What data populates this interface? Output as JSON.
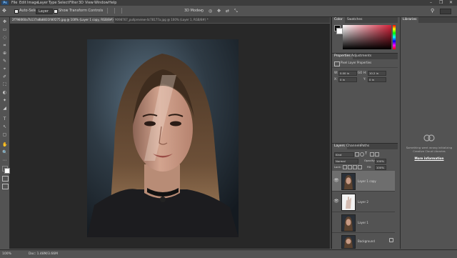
{
  "app": {
    "logo": "Ps"
  },
  "menu": [
    "File",
    "Edit",
    "Image",
    "Layer",
    "Type",
    "Select",
    "Filter",
    "3D",
    "View",
    "Window",
    "Help"
  ],
  "window_controls": {
    "minimize": "–",
    "restore": "❐",
    "close": "✕"
  },
  "options_bar": {
    "auto_select_label": "Auto-Select:",
    "auto_select_value": "Layer",
    "show_transform_label": "Show Transform Controls",
    "mode_3d_label": "3D Mode:"
  },
  "document_tabs": [
    {
      "label": "2f798060a7b137a8b8831f46f275.jpg @ 100% (Layer 1 copy, RGB/8#) *",
      "active": true
    },
    {
      "label": "9098767_pullpreview-4c78177a.jpg @ 100% (Layer 1, RGB/8#) *",
      "active": false
    }
  ],
  "status_bar": {
    "zoom": "100%",
    "doc_size": "Doc: 1.48M/3.66M"
  },
  "tools": [
    "✥",
    "▭",
    "◌",
    "⌗",
    "⊕",
    "✎",
    "⌖",
    "✐",
    "⛶",
    "◐",
    "✦",
    "◢",
    "T",
    "↖",
    "▢",
    "✋",
    "🔍",
    "⋯"
  ],
  "color_panel": {
    "tabs": [
      "Color",
      "Swatches"
    ],
    "foreground": "#0d0d0d",
    "background": "#ffffff",
    "hue_color": "#d4223a"
  },
  "properties_panel": {
    "tabs": [
      "Properties",
      "Adjustments"
    ],
    "title": "Pixel Layer Properties",
    "fields": {
      "w_label": "W:",
      "w_value": "0.00 in",
      "h_label": "H:",
      "h_value": "10.2 in",
      "x_label": "X:",
      "x_value": "0 in",
      "y_label": "Y:",
      "y_value": "0 in",
      "link_label": "GO"
    }
  },
  "layers_panel": {
    "tabs": [
      "Layers",
      "Channels",
      "Paths"
    ],
    "kind_label": "Kind",
    "blend_mode": "Normal",
    "opacity_label": "Opacity:",
    "opacity_value": "100%",
    "lock_label": "Lock:",
    "fill_label": "Fill:",
    "fill_value": "100%",
    "layers": [
      {
        "name": "Layer 1 copy",
        "selected": true,
        "visible": true,
        "thumb": "portrait-dark"
      },
      {
        "name": "Layer 2",
        "selected": false,
        "visible": true,
        "thumb": "hand-light"
      },
      {
        "name": "Layer 1",
        "selected": false,
        "visible": false,
        "thumb": "portrait"
      },
      {
        "name": "Background",
        "selected": false,
        "visible": false,
        "thumb": "portrait",
        "locked": true
      }
    ],
    "footer_icons": [
      "link-icon",
      "fx-icon",
      "mask-icon",
      "adjustment-icon",
      "folder-icon",
      "new-layer-icon",
      "trash-icon"
    ]
  },
  "libraries_panel": {
    "tab": "Libraries",
    "message": "Something went wrong initializing Creative Cloud Libraries",
    "link": "More information"
  }
}
